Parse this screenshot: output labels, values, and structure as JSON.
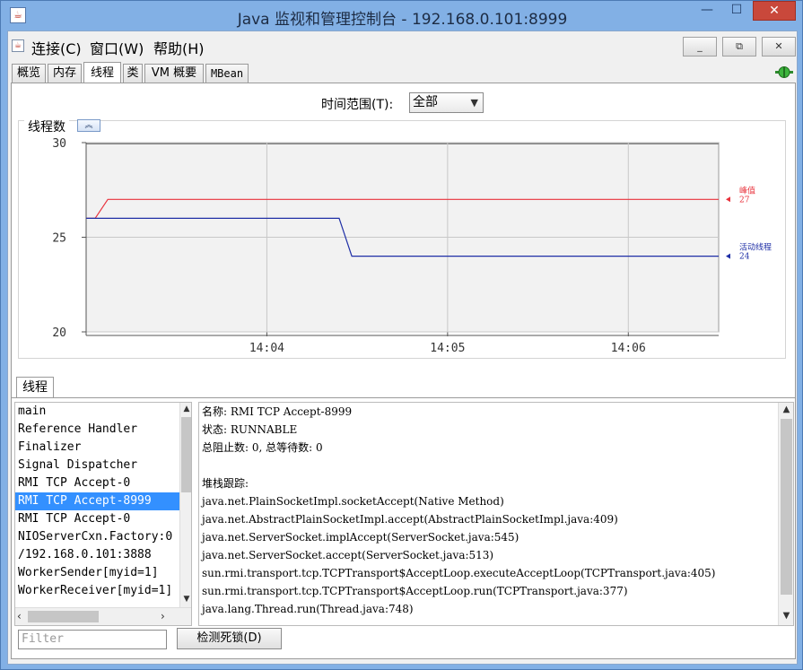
{
  "window": {
    "title": "Java 监视和管理控制台 - 192.168.0.101:8999",
    "min_label": "—",
    "max_label": "☐",
    "close_label": "✕"
  },
  "menu": {
    "items": [
      "连接(C)",
      "窗口(W)",
      "帮助(H)"
    ],
    "mdi_min": "_",
    "mdi_restore": "⧉",
    "mdi_close": "✕"
  },
  "tabs": [
    "概览",
    "内存",
    "线程",
    "类",
    "VM 概要",
    "MBean"
  ],
  "active_tab": "线程",
  "time_range": {
    "label": "时间范围(T):",
    "value": "全部"
  },
  "chart_panel": {
    "title": "线程数",
    "collapse_icon": "chevron-double-up-icon"
  },
  "chart_data": {
    "type": "line",
    "title": "线程数",
    "y_ticks": [
      "30",
      "25",
      "20"
    ],
    "ylim": [
      20,
      30
    ],
    "x_ticks": [
      "14:04",
      "14:05",
      "14:06"
    ],
    "x_tick_minutes": [
      64,
      65,
      66
    ],
    "xlim_minutes": [
      63.0,
      66.5
    ],
    "grid": true,
    "series": [
      {
        "name": "峰值",
        "color": "#e8323c",
        "current": "27",
        "x_minutes": [
          63.0,
          63.05,
          63.12,
          66.5
        ],
        "values": [
          26,
          26,
          27,
          27
        ]
      },
      {
        "name": "活动线程",
        "color": "#1f2fa6",
        "current": "24",
        "x_minutes": [
          63.0,
          64.4,
          64.47,
          66.5
        ],
        "values": [
          26,
          26,
          24,
          24
        ]
      }
    ]
  },
  "threads_tab": {
    "label": "线程",
    "list": [
      "main",
      "Reference Handler",
      "Finalizer",
      "Signal Dispatcher",
      "RMI TCP Accept-0",
      "RMI TCP Accept-8999",
      "RMI TCP Accept-0",
      "NIOServerCxn.Factory:0",
      "/192.168.0.101:3888",
      "WorkerSender[myid=1]",
      "WorkerReceiver[myid=1]"
    ],
    "selected_index": 5,
    "details": [
      "名称: RMI TCP Accept-8999",
      "状态: RUNNABLE",
      "总阻止数: 0, 总等待数: 0",
      "",
      "堆栈跟踪:",
      "java.net.PlainSocketImpl.socketAccept(Native Method)",
      "java.net.AbstractPlainSocketImpl.accept(AbstractPlainSocketImpl.java:409)",
      "java.net.ServerSocket.implAccept(ServerSocket.java:545)",
      "java.net.ServerSocket.accept(ServerSocket.java:513)",
      "sun.rmi.transport.tcp.TCPTransport$AcceptLoop.executeAcceptLoop(TCPTransport.java:405)",
      "sun.rmi.transport.tcp.TCPTransport$AcceptLoop.run(TCPTransport.java:377)",
      "java.lang.Thread.run(Thread.java:748)"
    ],
    "filter_placeholder": "Filter",
    "deadlock_button": "检测死锁(D)"
  }
}
